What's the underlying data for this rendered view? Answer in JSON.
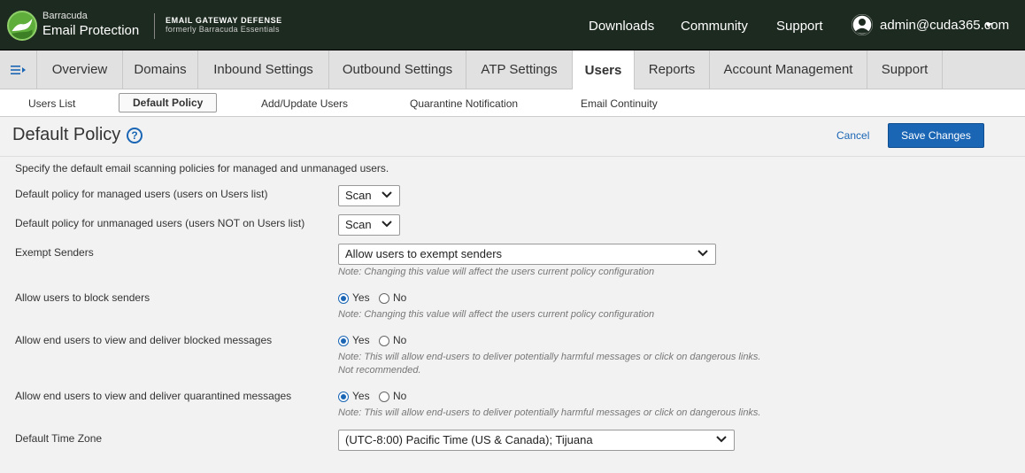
{
  "brand": {
    "company": "Barracuda",
    "product_line": "Email Protection",
    "product_name": "EMAIL GATEWAY DEFENSE",
    "product_sub": "formerly Barracuda Essentials"
  },
  "topnav": {
    "downloads": "Downloads",
    "community": "Community",
    "support": "Support",
    "user": "admin@cuda365.com"
  },
  "tabs": [
    "Overview",
    "Domains",
    "Inbound Settings",
    "Outbound Settings",
    "ATP Settings",
    "Users",
    "Reports",
    "Account Management",
    "Support"
  ],
  "subtabs": [
    "Users List",
    "Default Policy",
    "Add/Update Users",
    "Quarantine Notification",
    "Email Continuity"
  ],
  "header": {
    "title": "Default Policy",
    "help": "?",
    "cancel": "Cancel",
    "save": "Save Changes"
  },
  "form": {
    "intro": "Specify the default email scanning policies for managed and unmanaged users.",
    "managed": {
      "label": "Default policy for managed users (users on Users list)",
      "value": "Scan"
    },
    "unmanaged": {
      "label": "Default policy for unmanaged users (users NOT on Users list)",
      "value": "Scan"
    },
    "exempt": {
      "label": "Exempt Senders",
      "value": "Allow users to exempt senders",
      "note": "Note: Changing this value will affect the users current policy configuration"
    },
    "block": {
      "label": "Allow users to block senders",
      "yes": "Yes",
      "no": "No",
      "note": "Note: Changing this value will affect the users current policy configuration"
    },
    "blocked_msgs": {
      "label": "Allow end users to view and deliver blocked messages",
      "yes": "Yes",
      "no": "No",
      "note1": "Note: This will allow end-users to deliver potentially harmful messages or click on dangerous links.",
      "note2": "Not recommended."
    },
    "quarantined_msgs": {
      "label": "Allow end users to view and deliver quarantined messages",
      "yes": "Yes",
      "no": "No",
      "note": "Note: This will allow end-users to deliver potentially harmful messages or click on dangerous links."
    },
    "timezone": {
      "label": "Default Time Zone",
      "value": "(UTC-8:00) Pacific Time (US & Canada); Tijuana"
    }
  },
  "colors": {
    "accent": "#1a66b5",
    "topbar": "#1d2a20",
    "brand_green": "#5fae3c"
  }
}
